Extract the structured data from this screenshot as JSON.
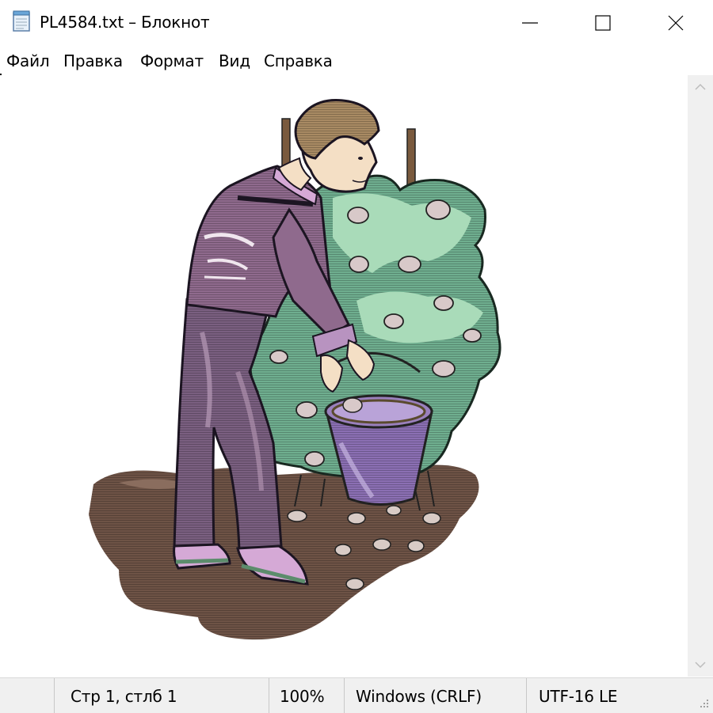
{
  "window": {
    "title": "PL4584.txt – Блокнот"
  },
  "menu": {
    "items": [
      "Файл",
      "Правка",
      "Формат",
      "Вид",
      "Справка"
    ]
  },
  "status": {
    "position": "Стр 1, стлб 1",
    "zoom": "100%",
    "line_endings": "Windows (CRLF)",
    "encoding": "UTF-16 LE"
  },
  "icons": {
    "app": "notepad-icon",
    "minimize": "minimize-icon",
    "maximize": "maximize-icon",
    "close": "close-icon",
    "scroll_up": "chevron-up-icon",
    "scroll_down": "chevron-down-icon",
    "grip": "resize-grip-icon"
  },
  "colors": {
    "soil": "#6e5346",
    "bush_dark": "#5f9f82",
    "bush_light": "#a9dbb9",
    "shirt": "#8f6a8d",
    "pants": "#7a5f80",
    "bucket": "#8b6fb3",
    "skin": "#f4dfc5",
    "hair": "#a88a63"
  }
}
